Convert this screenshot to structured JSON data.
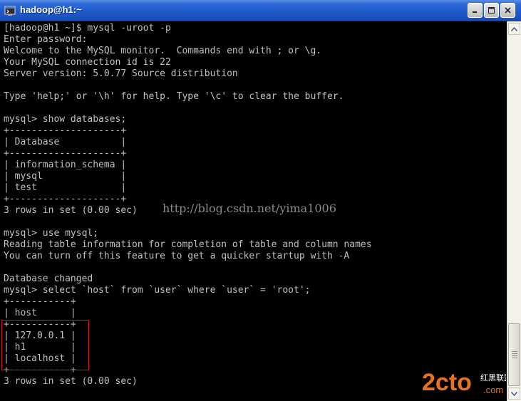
{
  "window": {
    "title": "hadoop@h1:~",
    "buttons": {
      "minimize": "minimize",
      "maximize": "maximize",
      "close": "close"
    }
  },
  "terminal": {
    "lines": [
      "[hadoop@h1 ~]$ mysql -uroot -p",
      "Enter password:",
      "Welcome to the MySQL monitor.  Commands end with ; or \\g.",
      "Your MySQL connection id is 22",
      "Server version: 5.0.77 Source distribution",
      "",
      "Type 'help;' or '\\h' for help. Type '\\c' to clear the buffer.",
      "",
      "mysql> show databases;",
      "+--------------------+",
      "| Database           |",
      "+--------------------+",
      "| information_schema |",
      "| mysql              |",
      "| test               |",
      "+--------------------+",
      "3 rows in set (0.00 sec)",
      "",
      "mysql> use mysql;",
      "Reading table information for completion of table and column names",
      "You can turn off this feature to get a quicker startup with -A",
      "",
      "Database changed",
      "mysql> select `host` from `user` where `user` = 'root';",
      "+-----------+",
      "| host      |",
      "+-----------+",
      "| 127.0.0.1 |",
      "| h1        |",
      "| localhost |",
      "+-----------+",
      "3 rows in set (0.00 sec)"
    ],
    "text_color": "#c0c0c0",
    "background": "#000000"
  },
  "watermark": {
    "text": "http://blog.csdn.net/yima1006"
  },
  "logo": {
    "brand": "2cto",
    "suffix": ".com",
    "tag": "红黑联盟",
    "colors": {
      "primary": "#e8731c"
    }
  },
  "highlight": {
    "color": "#d81818"
  }
}
